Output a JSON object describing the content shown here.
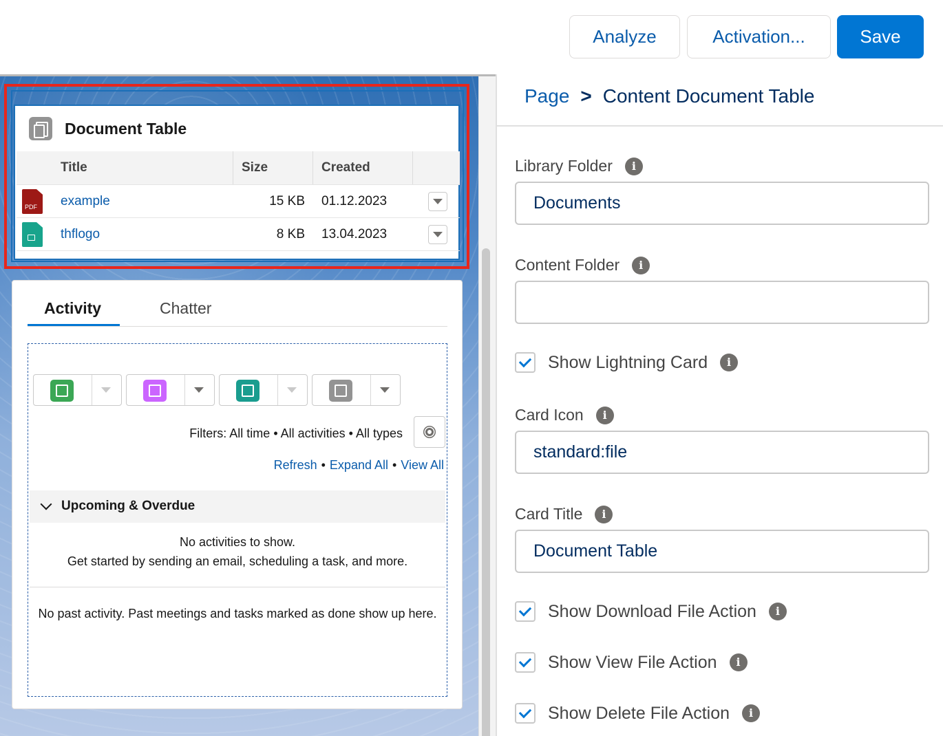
{
  "header": {
    "analyze_label": "Analyze",
    "activation_label": "Activation...",
    "save_label": "Save"
  },
  "document_card": {
    "title": "Document Table",
    "columns": [
      "Title",
      "Size",
      "Created"
    ],
    "rows": [
      {
        "title": "example",
        "size": "15 KB",
        "created": "01.12.2023",
        "type_label": "PDF",
        "icon": "pdf-file-icon"
      },
      {
        "title": "thflogo",
        "size": "8 KB",
        "created": "13.04.2023",
        "type_label": "",
        "icon": "image-file-icon"
      }
    ]
  },
  "activity_card": {
    "tabs": [
      "Activity",
      "Chatter"
    ],
    "publisher_icons": [
      "task-icon",
      "event-icon",
      "call-icon",
      "email-icon"
    ],
    "filters": "Filters: All time • All activities • All types",
    "links": [
      "Refresh",
      "Expand All",
      "View All"
    ],
    "upcoming_label": "Upcoming & Overdue",
    "no_activities_line1": "No activities to show.",
    "no_activities_line2": "Get started by sending an email, scheduling a task, and more.",
    "no_past_activity": "No past activity. Past meetings and tasks marked as done show up here."
  },
  "panel": {
    "breadcrumb_page": "Page",
    "breadcrumb_separator": ">",
    "breadcrumb_current": "Content Document Table",
    "fields": {
      "library_folder_label": "Library Folder",
      "library_folder_value": "Documents",
      "content_folder_label": "Content Folder",
      "content_folder_value": "",
      "show_lightning_card_label": "Show Lightning Card",
      "card_icon_label": "Card Icon",
      "card_icon_value": "standard:file",
      "card_title_label": "Card Title",
      "card_title_value": "Document Table",
      "show_download_label": "Show Download File Action",
      "show_view_label": "Show View File Action",
      "show_delete_label": "Show Delete File Action"
    },
    "checkboxes": {
      "show_lightning_card": true,
      "show_download": true,
      "show_view": true,
      "show_delete": true
    }
  },
  "colors": {
    "brand": "#0176d3",
    "link": "#0b5cab",
    "selection": "#e8261c"
  }
}
